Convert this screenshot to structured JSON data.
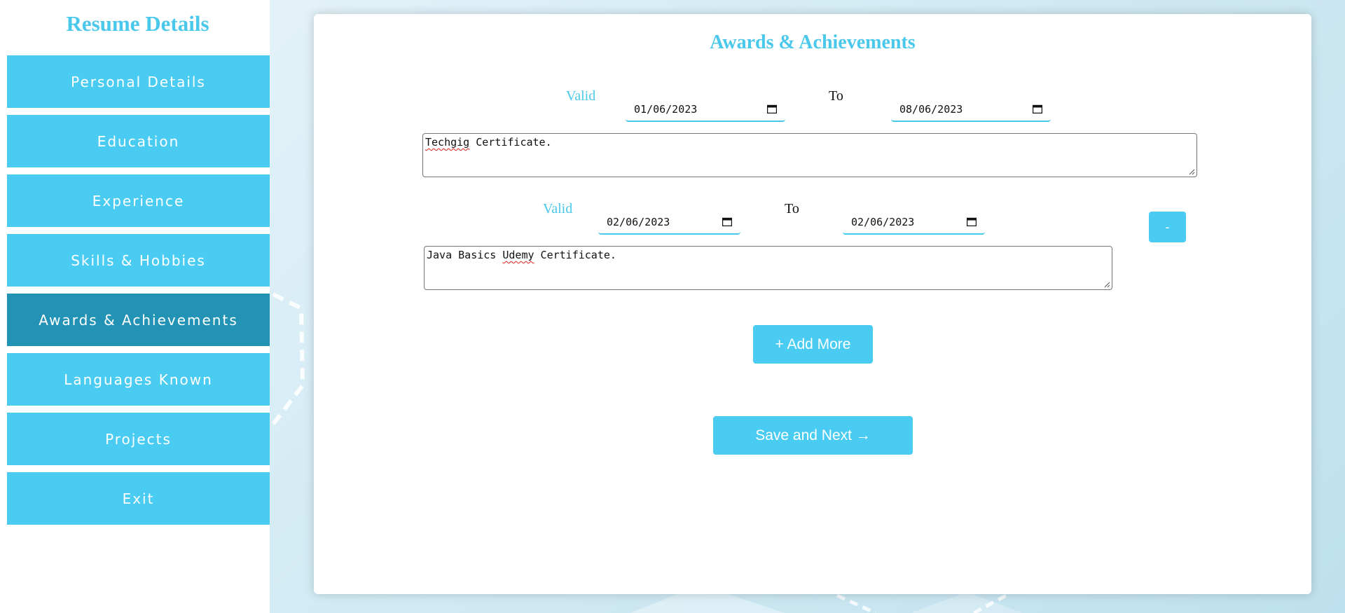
{
  "sidebar": {
    "title": "Resume Details",
    "items": [
      {
        "label": "Personal Details"
      },
      {
        "label": "Education"
      },
      {
        "label": "Experience"
      },
      {
        "label": "Skills & Hobbies"
      },
      {
        "label": "Awards & Achievements",
        "active": true
      },
      {
        "label": "Languages Known"
      },
      {
        "label": "Projects"
      },
      {
        "label": "Exit"
      }
    ]
  },
  "main": {
    "title": "Awards & Achievements",
    "entries": [
      {
        "valid_label": "Valid",
        "from_date": "01/06/2023",
        "to_label": "To",
        "to_date": "08/06/2023",
        "description_parts": [
          "Techgig",
          " Certificate."
        ]
      },
      {
        "valid_label": "Valid",
        "from_date": "02/06/2023",
        "to_label": "To",
        "to_date": "02/06/2023",
        "description_parts": [
          "Java Basics ",
          "Udemy",
          " Certificate."
        ],
        "remove_label": "-"
      }
    ],
    "add_more_label": "+ Add More",
    "save_next_label": "Save and Next →"
  },
  "colors": {
    "accent": "#4accf2",
    "accent_dark": "#2292b5",
    "heading": "#4ac8ec"
  }
}
